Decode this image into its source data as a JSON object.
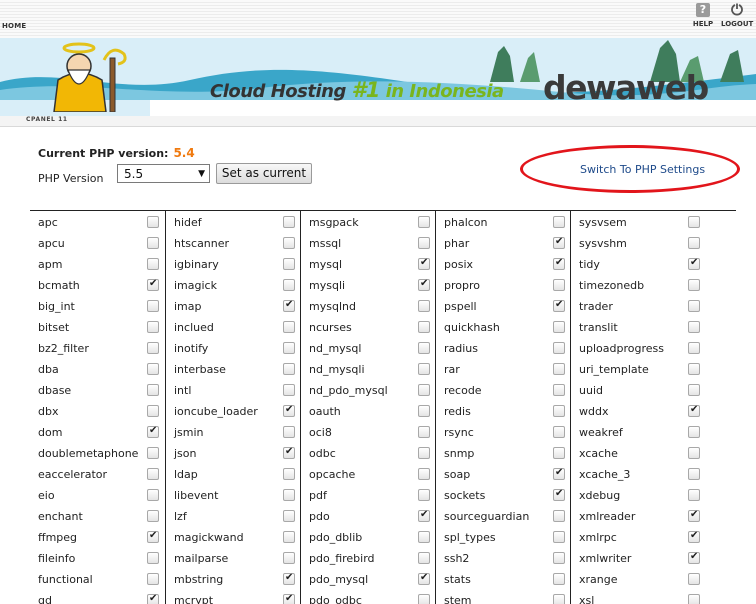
{
  "topnav": {
    "home": "HOME",
    "help": "HELP",
    "logout": "LOGOUT"
  },
  "banner": {
    "slogan_a": "Cloud Hosting ",
    "slogan_num": "#1",
    "slogan_b": " in Indonesia",
    "brand": "dewaweb"
  },
  "cpanel": {
    "label": "CPANEL 11"
  },
  "php": {
    "current_label": "Current PHP version:",
    "current_value": "5.4",
    "version_label": "PHP Version",
    "selected": "5.5",
    "set_button": "Set as current",
    "switch_link": "Switch To PHP Settings"
  },
  "extension_columns": [
    [
      {
        "name": "apc",
        "checked": false
      },
      {
        "name": "apcu",
        "checked": false
      },
      {
        "name": "apm",
        "checked": false
      },
      {
        "name": "bcmath",
        "checked": true
      },
      {
        "name": "big_int",
        "checked": false
      },
      {
        "name": "bitset",
        "checked": false
      },
      {
        "name": "bz2_filter",
        "checked": false
      },
      {
        "name": "dba",
        "checked": false
      },
      {
        "name": "dbase",
        "checked": false
      },
      {
        "name": "dbx",
        "checked": false
      },
      {
        "name": "dom",
        "checked": true
      },
      {
        "name": "doublemetaphone",
        "checked": false
      },
      {
        "name": "eaccelerator",
        "checked": false
      },
      {
        "name": "eio",
        "checked": false
      },
      {
        "name": "enchant",
        "checked": false
      },
      {
        "name": "ffmpeg",
        "checked": true
      },
      {
        "name": "fileinfo",
        "checked": false
      },
      {
        "name": "functional",
        "checked": false
      },
      {
        "name": "gd",
        "checked": true
      }
    ],
    [
      {
        "name": "hidef",
        "checked": false
      },
      {
        "name": "htscanner",
        "checked": false
      },
      {
        "name": "igbinary",
        "checked": false
      },
      {
        "name": "imagick",
        "checked": false
      },
      {
        "name": "imap",
        "checked": true
      },
      {
        "name": "inclued",
        "checked": false
      },
      {
        "name": "inotify",
        "checked": false
      },
      {
        "name": "interbase",
        "checked": false
      },
      {
        "name": "intl",
        "checked": false
      },
      {
        "name": "ioncube_loader",
        "checked": true
      },
      {
        "name": "jsmin",
        "checked": false
      },
      {
        "name": "json",
        "checked": true
      },
      {
        "name": "ldap",
        "checked": false
      },
      {
        "name": "libevent",
        "checked": false
      },
      {
        "name": "lzf",
        "checked": false
      },
      {
        "name": "magickwand",
        "checked": false
      },
      {
        "name": "mailparse",
        "checked": false
      },
      {
        "name": "mbstring",
        "checked": true
      },
      {
        "name": "mcrypt",
        "checked": true
      }
    ],
    [
      {
        "name": "msgpack",
        "checked": false
      },
      {
        "name": "mssql",
        "checked": false
      },
      {
        "name": "mysql",
        "checked": true
      },
      {
        "name": "mysqli",
        "checked": true
      },
      {
        "name": "mysqlnd",
        "checked": false
      },
      {
        "name": "ncurses",
        "checked": false
      },
      {
        "name": "nd_mysql",
        "checked": false
      },
      {
        "name": "nd_mysqli",
        "checked": false
      },
      {
        "name": "nd_pdo_mysql",
        "checked": false
      },
      {
        "name": "oauth",
        "checked": false
      },
      {
        "name": "oci8",
        "checked": false
      },
      {
        "name": "odbc",
        "checked": false
      },
      {
        "name": "opcache",
        "checked": false
      },
      {
        "name": "pdf",
        "checked": false
      },
      {
        "name": "pdo",
        "checked": true
      },
      {
        "name": "pdo_dblib",
        "checked": false
      },
      {
        "name": "pdo_firebird",
        "checked": false
      },
      {
        "name": "pdo_mysql",
        "checked": true
      },
      {
        "name": "pdo_odbc",
        "checked": false
      }
    ],
    [
      {
        "name": "phalcon",
        "checked": false
      },
      {
        "name": "phar",
        "checked": true
      },
      {
        "name": "posix",
        "checked": true
      },
      {
        "name": "propro",
        "checked": false
      },
      {
        "name": "pspell",
        "checked": true
      },
      {
        "name": "quickhash",
        "checked": false
      },
      {
        "name": "radius",
        "checked": false
      },
      {
        "name": "rar",
        "checked": false
      },
      {
        "name": "recode",
        "checked": false
      },
      {
        "name": "redis",
        "checked": false
      },
      {
        "name": "rsync",
        "checked": false
      },
      {
        "name": "snmp",
        "checked": false
      },
      {
        "name": "soap",
        "checked": true
      },
      {
        "name": "sockets",
        "checked": true
      },
      {
        "name": "sourceguardian",
        "checked": false
      },
      {
        "name": "spl_types",
        "checked": false
      },
      {
        "name": "ssh2",
        "checked": false
      },
      {
        "name": "stats",
        "checked": false
      },
      {
        "name": "stem",
        "checked": false
      }
    ],
    [
      {
        "name": "sysvsem",
        "checked": false
      },
      {
        "name": "sysvshm",
        "checked": false
      },
      {
        "name": "tidy",
        "checked": true
      },
      {
        "name": "timezonedb",
        "checked": false
      },
      {
        "name": "trader",
        "checked": false
      },
      {
        "name": "translit",
        "checked": false
      },
      {
        "name": "uploadprogress",
        "checked": false
      },
      {
        "name": "uri_template",
        "checked": false
      },
      {
        "name": "uuid",
        "checked": false
      },
      {
        "name": "wddx",
        "checked": true
      },
      {
        "name": "weakref",
        "checked": false
      },
      {
        "name": "xcache",
        "checked": false
      },
      {
        "name": "xcache_3",
        "checked": false
      },
      {
        "name": "xdebug",
        "checked": false
      },
      {
        "name": "xmlreader",
        "checked": true
      },
      {
        "name": "xmlrpc",
        "checked": true
      },
      {
        "name": "xmlwriter",
        "checked": true
      },
      {
        "name": "xrange",
        "checked": false
      },
      {
        "name": "xsl",
        "checked": false
      }
    ]
  ]
}
